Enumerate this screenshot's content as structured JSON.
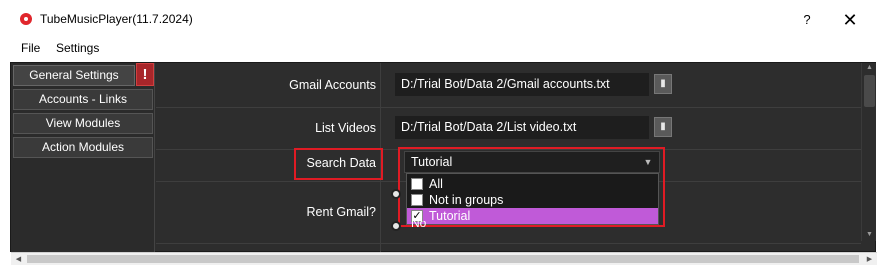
{
  "window": {
    "title": "TubeMusicPlayer(11.7.2024)",
    "help_glyph": "?",
    "close_glyph": "✕"
  },
  "menu": {
    "file": "File",
    "settings": "Settings"
  },
  "sidebar": {
    "items": [
      {
        "label": "General Settings"
      },
      {
        "label": "Accounts - Links"
      },
      {
        "label": "View Modules"
      },
      {
        "label": "Action Modules"
      }
    ],
    "alert_glyph": "!"
  },
  "form": {
    "gmail_accounts": {
      "label": "Gmail Accounts",
      "value": "D:/Trial Bot/Data 2/Gmail accounts.txt"
    },
    "list_videos": {
      "label": "List Videos",
      "value": "D:/Trial Bot/Data 2/List video.txt"
    },
    "search_data": {
      "label": "Search Data",
      "selected": "Tutorial",
      "options": [
        {
          "label": "All",
          "checked": false
        },
        {
          "label": "Not in groups",
          "checked": false
        },
        {
          "label": "Tutorial",
          "checked": true
        }
      ]
    },
    "rent_gmail": {
      "label": "Rent Gmail?",
      "no_label": "No"
    },
    "check_glyph": "✓",
    "folder_glyph": "▮"
  },
  "colors": {
    "highlight": "#e01b24",
    "selected_option": "#c05ad8",
    "alert_badge": "#a8262a",
    "background": "#2d2d2d"
  },
  "icons": [
    "app-icon",
    "help-icon",
    "close-icon",
    "alert-icon",
    "folder-icon",
    "chevron-down-icon",
    "checkbox-icon"
  ]
}
